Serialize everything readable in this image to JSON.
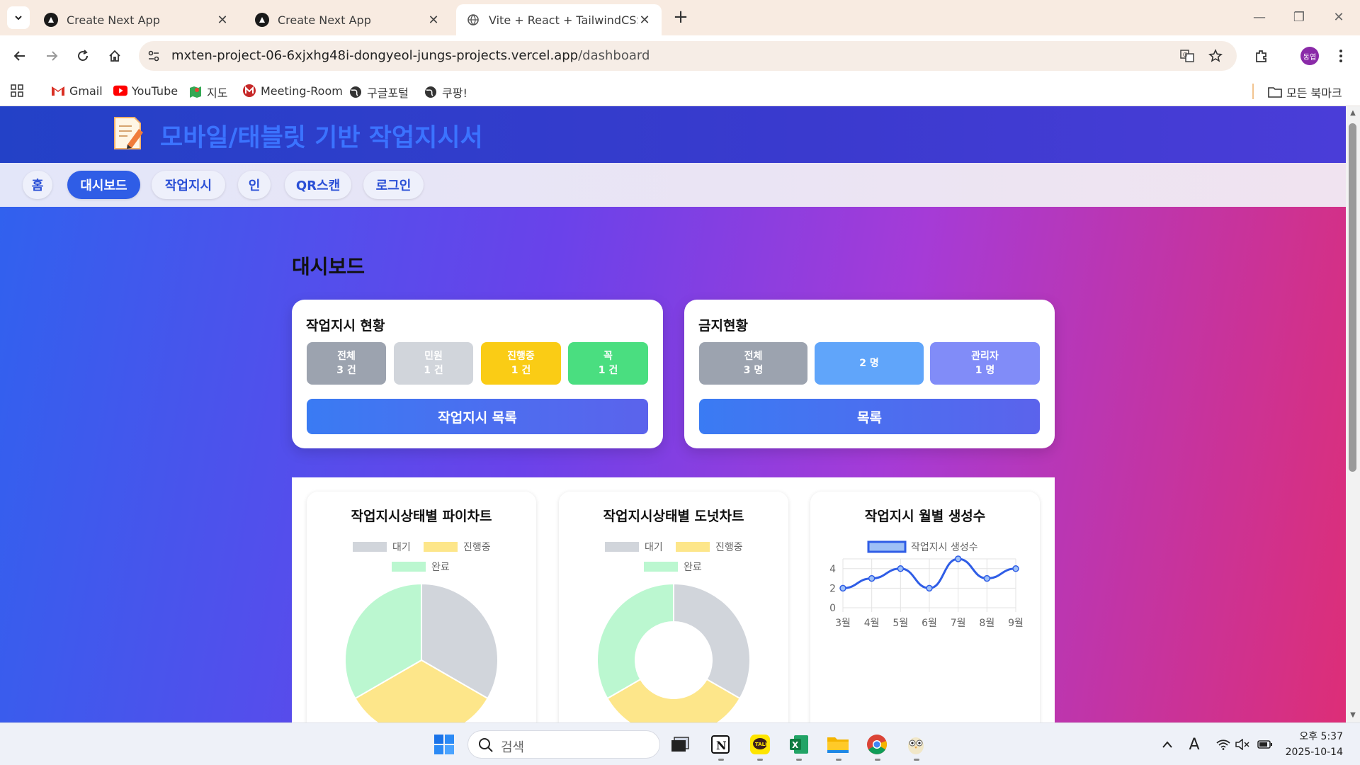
{
  "browser": {
    "tabs": [
      {
        "title": "Create Next App",
        "active": false
      },
      {
        "title": "Create Next App",
        "active": false
      },
      {
        "title": "Vite + React + TailwindCSS",
        "active": true
      }
    ],
    "url_domain": "mxten-project-06-6xjxhg48i-dongyeol-jungs-projects.vercel.app",
    "url_path": "/dashboard",
    "profile_initial": "동엽",
    "bookmarks": [
      "Gmail",
      "YouTube",
      "지도",
      "Meeting-Room",
      "구글포털",
      "쿠팡!"
    ],
    "all_bookmarks": "모든 북마크"
  },
  "app": {
    "title": "모바일/태블릿 기반 작업지시서",
    "nav": [
      "홈",
      "대시보드",
      "작업지시",
      "인",
      "QR스캔",
      "로그인"
    ],
    "active_nav": "대시보드",
    "page_title": "대시보드"
  },
  "work_status": {
    "title": "작업지시 현황",
    "stats": [
      {
        "label": "전체",
        "value": "3 건",
        "color": "#9ca3af"
      },
      {
        "label": "민원",
        "value": "1 건",
        "color": "#d1d5db"
      },
      {
        "label": "진행중",
        "value": "1 건",
        "color": "#facc15"
      },
      {
        "label": "꼭",
        "value": "1 건",
        "color": "#4ade80"
      }
    ],
    "button": "작업지시 목록"
  },
  "ban_status": {
    "title": "금지현황",
    "stats": [
      {
        "label": "전체",
        "value": "3 명",
        "color": "#9ca3af"
      },
      {
        "label": "",
        "value": "2 명",
        "color": "#60a5fa"
      },
      {
        "label": "관리자",
        "value": "1 명",
        "color": "#818cf8"
      }
    ],
    "button": "목록"
  },
  "charts": {
    "pie_title": "작업지시상태별 파이차트",
    "donut_title": "작업지시상태별 도넛차트",
    "line_title": "작업지시 월별 생성수"
  },
  "chart_data": [
    {
      "type": "pie",
      "title": "작업지시상태별 파이차트",
      "categories": [
        "대기",
        "진행중",
        "완료"
      ],
      "values": [
        1,
        1,
        1
      ],
      "colors": [
        "#d1d5db",
        "#fde68a",
        "#bbf7d0"
      ],
      "legend": "top"
    },
    {
      "type": "pie",
      "variant": "donut",
      "title": "작업지시상태별 도넛차트",
      "categories": [
        "대기",
        "진행중",
        "완료"
      ],
      "values": [
        1,
        1,
        1
      ],
      "colors": [
        "#d1d5db",
        "#fde68a",
        "#bbf7d0"
      ],
      "legend": "top"
    },
    {
      "type": "line",
      "title": "작업지시 월별 생성수",
      "categories": [
        "3월",
        "4월",
        "5월",
        "6월",
        "7월",
        "8월",
        "9월"
      ],
      "series": [
        {
          "name": "작업지시 생성수",
          "values": [
            2,
            3,
            4,
            2,
            5,
            3,
            4
          ]
        }
      ],
      "yticks": [
        0,
        2,
        4
      ],
      "ylim": [
        0,
        5
      ],
      "grid": true,
      "color": "#2f5de6"
    }
  ],
  "taskbar": {
    "search_placeholder": "검색",
    "time": "오후 5:37",
    "date": "2025-10-14"
  }
}
